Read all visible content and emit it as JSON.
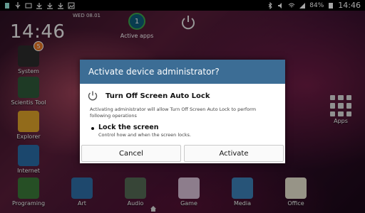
{
  "statusbar": {
    "battery": "84%",
    "time": "14:46"
  },
  "home": {
    "clock": "14:46",
    "date": "WED   08.01",
    "active_apps": {
      "count": "1",
      "label": "Active apps"
    },
    "apps_button": "Apps"
  },
  "left_apps": [
    {
      "label": "System",
      "badge": "5"
    },
    {
      "label": "Scientis Tool"
    },
    {
      "label": "Explorer"
    },
    {
      "label": "Internet"
    }
  ],
  "dock": [
    {
      "label": "Programing"
    },
    {
      "label": "Art"
    },
    {
      "label": "Audio"
    },
    {
      "label": "Game"
    },
    {
      "label": "Media"
    },
    {
      "label": "Office"
    }
  ],
  "dialog": {
    "title": "Activate device administrator?",
    "app_name": "Turn Off Screen Auto Lock",
    "description": "Activating administrator will allow Turn Off Screen Auto Lock to perform following operations",
    "permission": {
      "title": "Lock the screen",
      "subtitle": "Control how and when the screen locks."
    },
    "cancel_label": "Cancel",
    "activate_label": "Activate"
  },
  "colors": {
    "dialog_header": "#3c6d95",
    "badge": "#e87722",
    "active_apps_ring": "#3ea84a"
  }
}
